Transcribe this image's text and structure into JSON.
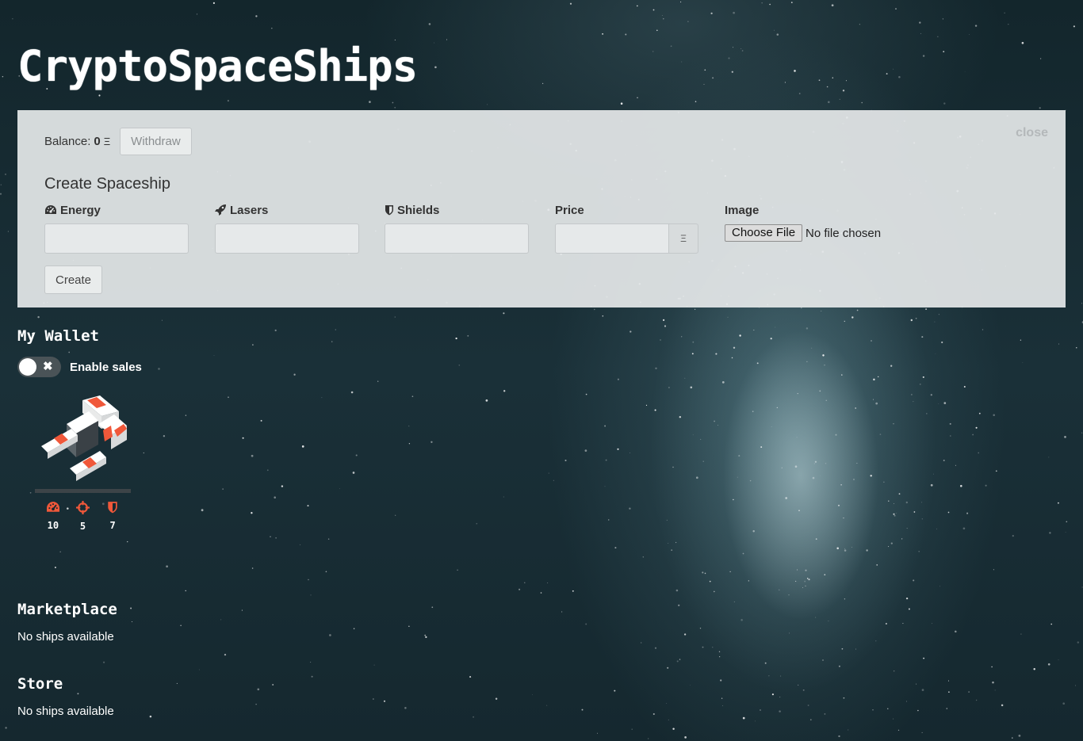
{
  "app": {
    "title": "CryptoSpaceShips"
  },
  "panel": {
    "close_label": "close",
    "balance_label": "Balance:",
    "balance_value": "0",
    "currency_symbol": "Ξ",
    "withdraw_label": "Withdraw",
    "create_title": "Create Spaceship",
    "fields": {
      "energy": "Energy",
      "lasers": "Lasers",
      "shields": "Shields",
      "price": "Price",
      "image": "Image"
    },
    "price_addon": "Ξ",
    "choose_file_label": "Choose File",
    "file_status": "No file chosen",
    "create_label": "Create"
  },
  "wallet": {
    "heading": "My Wallet",
    "enable_sales_label": "Enable sales",
    "toggle_symbol": "✖",
    "ships": [
      {
        "energy": "10",
        "lasers": "5",
        "shields": "7"
      }
    ]
  },
  "marketplace": {
    "heading": "Marketplace",
    "empty_text": "No ships available"
  },
  "store": {
    "heading": "Store",
    "empty_text": "No ships available"
  },
  "colors": {
    "accent": "#f0583a",
    "panel_bg": "#e4e7e8",
    "space_bg": "#15282f"
  }
}
